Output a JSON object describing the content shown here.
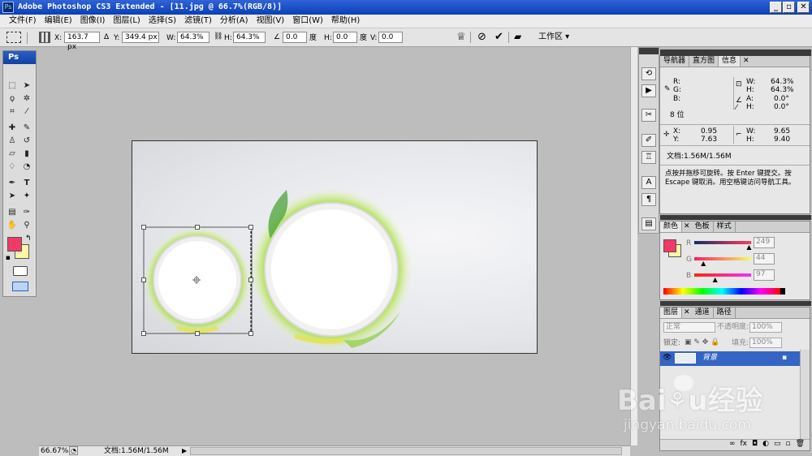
{
  "app": {
    "icon_text": "Ps",
    "title": "Adobe Photoshop CS3 Extended - [11.jpg @ 66.7%(RGB/8)]"
  },
  "window": {
    "minimize": "_",
    "restore": "▫",
    "close": "✕"
  },
  "menu": [
    "文件(F)",
    "编辑(E)",
    "图像(I)",
    "图层(L)",
    "选择(S)",
    "滤镜(T)",
    "分析(A)",
    "视图(V)",
    "窗口(W)",
    "帮助(H)"
  ],
  "options": {
    "x_label": "X:",
    "x_value": "163.7 px",
    "delta_icon": "Δ",
    "y_label": "Y:",
    "y_value": "349.4 px",
    "w_label": "W:",
    "w_value": "64.3%",
    "h_label": "H:",
    "h_value": "64.3%",
    "angle_value": "0.0",
    "angle_unit": "度",
    "hskew_label": "H:",
    "hskew_value": "0.0",
    "hskew_unit": "度",
    "vskew_label": "V:",
    "vskew_value": "0.0",
    "workspace": "工作区 ▾"
  },
  "toolbox": {
    "title": "Ps"
  },
  "colors": {
    "foreground": "#f23a66",
    "background": "#fff6a8",
    "accent": "#2f63d6"
  },
  "status": {
    "zoom": "66.67%",
    "doc": "文档:1.56M/1.56M"
  },
  "info_panel": {
    "tabs": [
      "导航器",
      "直方图",
      "信息"
    ],
    "r": "R:",
    "g": "G:",
    "b": "B:",
    "w_label": "W:",
    "w_value": "64.3%",
    "h_label": "H:",
    "h_value": "64.3%",
    "a_label": "A:",
    "a_value": "0.0°",
    "h2_label": "H:",
    "h2_value": "0.0°",
    "bits": "8 位",
    "x_label": "X:",
    "x_value": "0.95",
    "y_label": "Y:",
    "y_value": "7.63",
    "sw_label": "W:",
    "sw_value": "9.65",
    "sh_label": "H:",
    "sh_value": "9.40",
    "doc": "文档:1.56M/1.56M",
    "hint": "点按并拖移可旋转。按 Enter 键提交。按 Escape 键取消。用空格键访问导航工具。"
  },
  "color_panel": {
    "tabs": [
      "颜色",
      "色板",
      "样式"
    ],
    "r_label": "R",
    "r_value": "249",
    "g_label": "G",
    "g_value": "44",
    "b_label": "B",
    "b_value": "97",
    "r_level": 0.976,
    "g_level": 0.173,
    "b_level": 0.38
  },
  "layers_panel": {
    "tabs": [
      "图层",
      "通道",
      "路径"
    ],
    "blend_mode": "正常",
    "opacity_label": "不透明度:",
    "opacity_value": "100%",
    "lock_label": "锁定:",
    "fill_label": "填充:",
    "fill_value": "100%",
    "layer_name": "背景",
    "bottom_icons": [
      "∞",
      "fx",
      "◘",
      "◐",
      "▭",
      "▫",
      "🗑"
    ]
  },
  "watermark": {
    "brand": "Baidu经验",
    "url": "jingyan.baidu.com"
  }
}
